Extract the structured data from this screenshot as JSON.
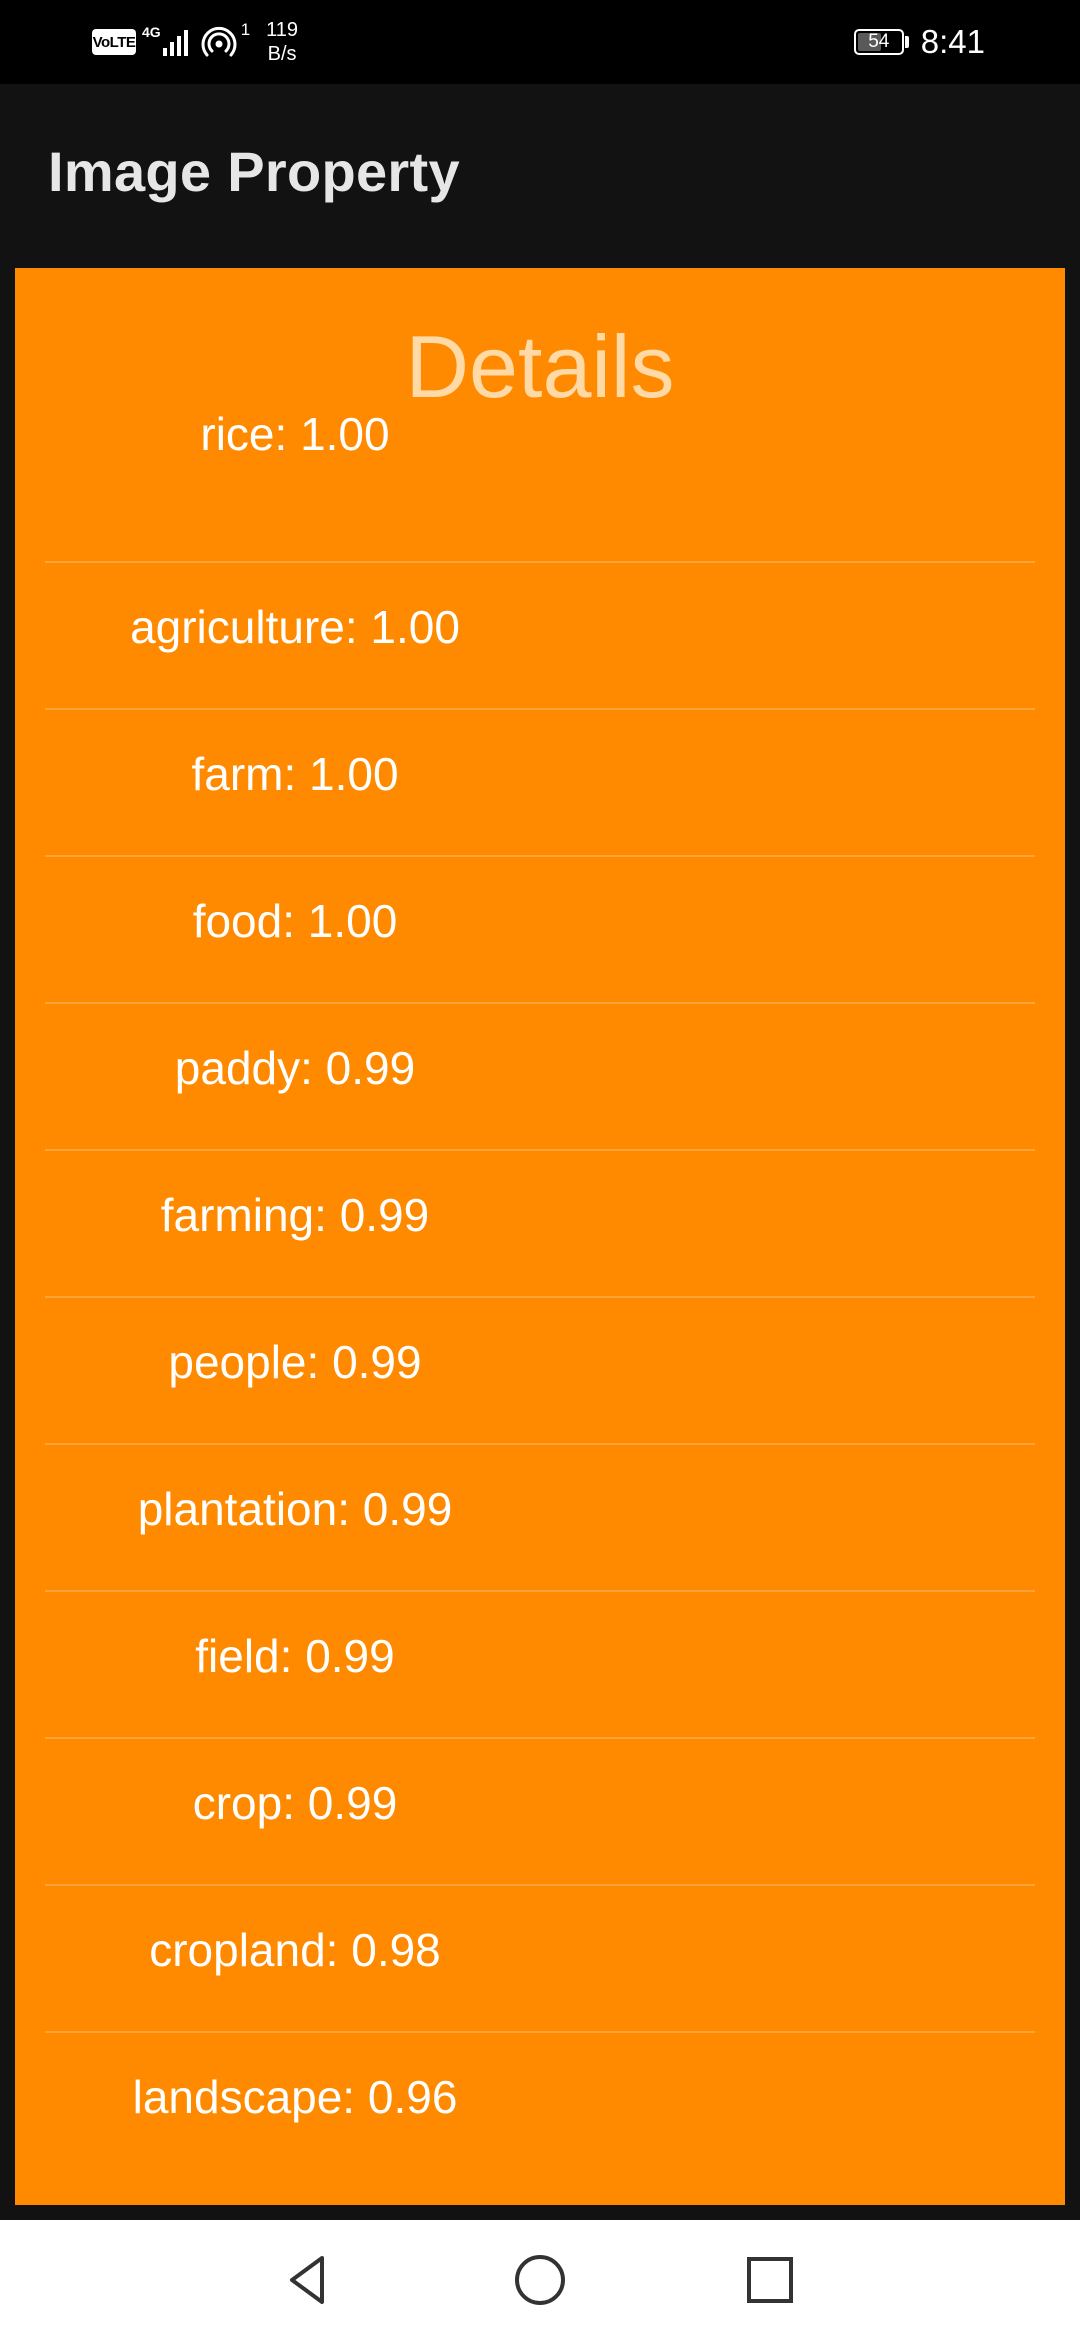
{
  "status_bar": {
    "volte": "VoLTE",
    "network": "4G",
    "hotspot_count": "1",
    "speed_value": "119",
    "speed_unit": "B/s",
    "battery": "54",
    "battery_level": 0.54,
    "time": "8:41"
  },
  "app_bar": {
    "title": "Image Property"
  },
  "card": {
    "title": "Details",
    "items": [
      "rice: 1.00",
      "agriculture: 1.00",
      "farm: 1.00",
      "food: 1.00",
      "paddy: 0.99",
      "farming: 0.99",
      "people: 0.99",
      "plantation: 0.99",
      "field: 0.99",
      "crop: 0.99",
      "cropland: 0.98",
      "landscape: 0.96"
    ]
  },
  "nav_bar": {
    "icons": [
      "back-icon",
      "home-icon",
      "recents-icon"
    ]
  },
  "colors": {
    "card_background": "#ff8a00",
    "title_color": "#ffd9a6",
    "app_bar_background": "#121212"
  }
}
